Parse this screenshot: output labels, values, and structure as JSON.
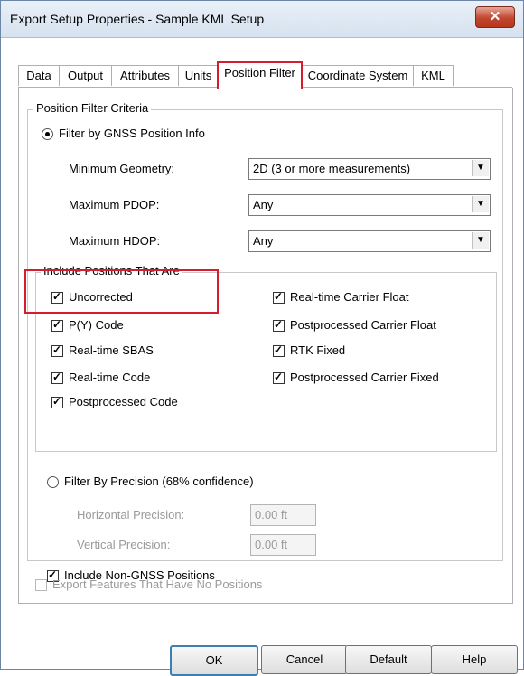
{
  "window": {
    "title": "Export Setup Properties - Sample KML Setup",
    "close_icon": "close-icon"
  },
  "tabs": [
    {
      "label": "Data"
    },
    {
      "label": "Output"
    },
    {
      "label": "Attributes"
    },
    {
      "label": "Units"
    },
    {
      "label": "Position Filter",
      "active": true
    },
    {
      "label": "Coordinate System"
    },
    {
      "label": "KML"
    }
  ],
  "criteria": {
    "group_title": "Position Filter Criteria",
    "filter_gnss_label": "Filter by GNSS Position Info",
    "min_geometry_label": "Minimum Geometry:",
    "min_geometry_value": "2D (3 or more measurements)",
    "max_pdop_label": "Maximum PDOP:",
    "max_pdop_value": "Any",
    "max_hdop_label": "Maximum HDOP:",
    "max_hdop_value": "Any",
    "include_group_title": "Include Positions That Are",
    "left_options": [
      {
        "label": "Uncorrected",
        "checked": true
      },
      {
        "label": "P(Y) Code",
        "checked": true
      },
      {
        "label": "Real-time SBAS",
        "checked": true
      },
      {
        "label": "Real-time Code",
        "checked": true
      },
      {
        "label": "Postprocessed Code",
        "checked": true
      }
    ],
    "right_options": [
      {
        "label": "Real-time Carrier Float",
        "checked": true
      },
      {
        "label": "Postprocessed Carrier Float",
        "checked": true
      },
      {
        "label": "RTK Fixed",
        "checked": true
      },
      {
        "label": "Postprocessed Carrier Fixed",
        "checked": true
      }
    ],
    "filter_precision_label": "Filter By Precision (68% confidence)",
    "horizontal_label": "Horizontal Precision:",
    "horizontal_value": "0.00 ft",
    "vertical_label": "Vertical Precision:",
    "vertical_value": "0.00 ft",
    "include_non_gnss_label": "Include Non-GNSS Positions"
  },
  "export_no_positions_label": "Export Features That Have No Positions",
  "buttons": {
    "ok": "OK",
    "cancel": "Cancel",
    "default": "Default",
    "help": "Help"
  },
  "colors": {
    "highlight": "#d21f2b",
    "titlebar": "#dbe6f2",
    "close": "#c0472f"
  }
}
